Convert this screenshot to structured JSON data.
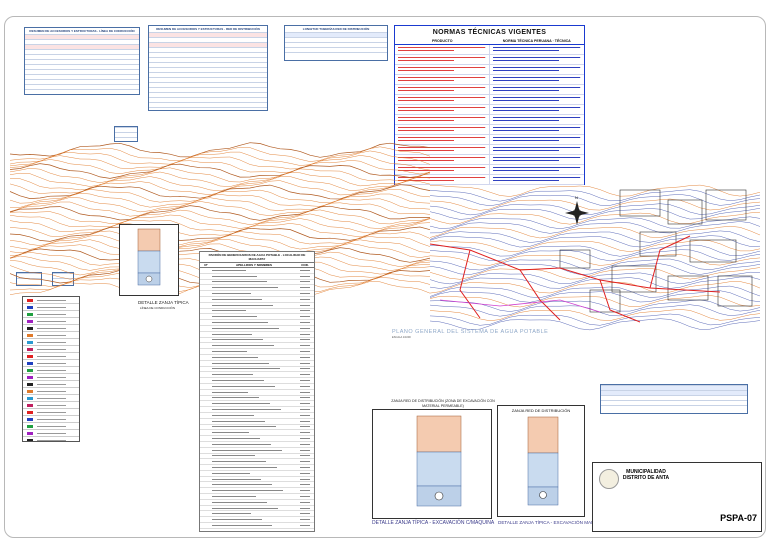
{
  "norms": {
    "title": "NORMAS TÉCNICAS VIGENTES",
    "col_product": "PRODUCTO",
    "col_norm": "NORMA TÉCNICA PERUANA · TÉCNICA",
    "rows": 14
  },
  "plan_title": "PLANO GENERAL DEL SISTEMA DE AGUA POTABLE",
  "plan_scale": "ESCALA 1/1000",
  "padron": {
    "title": "PADRÓN DE BENEFICIARIOS DE AGUA POTABLE · LOCALIDAD DE MACHAPAY",
    "col_num": "Nº",
    "col_name": "APELLIDOS Y NOMBRES",
    "col_code": "COD."
  },
  "zanja_red": {
    "title": "ZANJA RED DE DISTRIBUCIÓN (ZONA DE EXCAVACIÓN CON MATERIAL PERMEABLE)",
    "caption": "DETALLE ZANJA TÍPICA - EXCAVACIÓN C/MAQUINA"
  },
  "zanja_manual": {
    "title": "ZANJA RED DE DISTRIBUCIÓN",
    "caption": "DETALLE ZANJA TÍPICA - EXCAVACIÓN MANUAL"
  },
  "zanja_left": {
    "caption": "DETALLE ZANJA TÍPICA",
    "sub": "LÍNEA DE CONDUCCIÓN"
  },
  "title_block": {
    "entity": "MUNICIPALIDAD DISTRITO DE ANTA",
    "sheet_code": "PSPA-07"
  },
  "colors": {
    "contour_orange": "#e07a2a",
    "contour_blue": "#4a5ab0",
    "pipe_red": "#e02020",
    "border_blue": "#1a3ad0"
  }
}
